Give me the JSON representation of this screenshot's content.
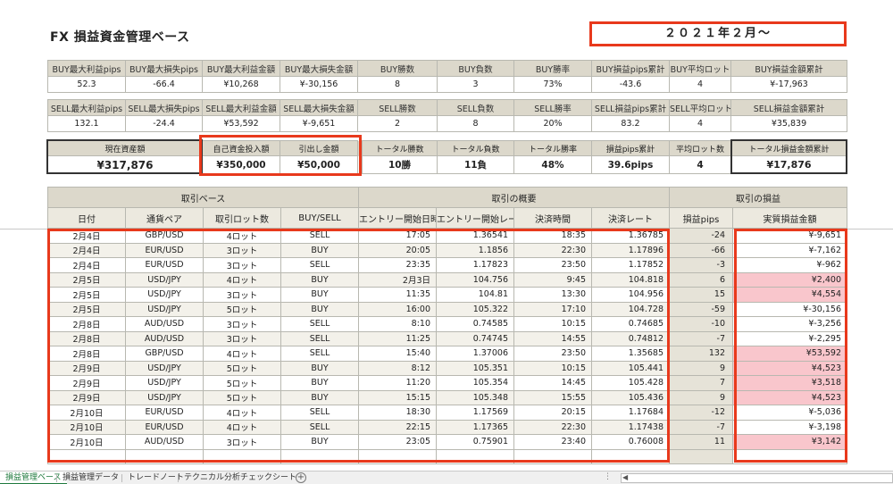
{
  "title": "FX 損益資金管理ベース",
  "date_label": "２０２１年２月～",
  "buy_stats": {
    "headers": [
      "BUY最大利益pips",
      "BUY最大損失pips",
      "BUY最大利益金額",
      "BUY最大損失金額",
      "BUY勝数",
      "BUY負数",
      "BUY勝率",
      "BUY損益pips累計",
      "BUY平均ロット",
      "BUY損益金額累計"
    ],
    "values": [
      "52.3",
      "-66.4",
      "¥10,268",
      "¥-30,156",
      "8",
      "3",
      "73%",
      "-43.6",
      "4",
      "¥-17,963"
    ]
  },
  "sell_stats": {
    "headers": [
      "SELL最大利益pips",
      "SELL最大損失pips",
      "SELL最大利益金額",
      "SELL最大損失金額",
      "SELL勝数",
      "SELL負数",
      "SELL勝率",
      "SELL損益pips累計",
      "SELL平均ロット",
      "SELL損益金額累計"
    ],
    "values": [
      "132.1",
      "-24.4",
      "¥53,592",
      "¥-9,651",
      "2",
      "8",
      "20%",
      "83.2",
      "4",
      "¥35,839"
    ]
  },
  "summary": {
    "current_assets_label": "現在資産額",
    "current_assets": "¥317,876",
    "investment_label": "自己資金投入額",
    "investment": "¥350,000",
    "withdrawal_label": "引出し金額",
    "withdrawal": "¥50,000",
    "total_wins_label": "トータル勝数",
    "total_wins": "10勝",
    "total_losses_label": "トータル負数",
    "total_losses": "11負",
    "total_winrate_label": "トータル勝率",
    "total_winrate": "48%",
    "pips_total_label": "損益pips累計",
    "pips_total": "39.6pips",
    "avg_lot_label": "平均ロット数",
    "avg_lot": "4",
    "total_pl_label": "トータル損益金額累計",
    "total_pl": "¥17,876"
  },
  "trade_table": {
    "groups": [
      "取引ベース",
      "取引の概要",
      "取引の損益"
    ],
    "columns": [
      "日付",
      "通貨ペア",
      "取引ロット数",
      "BUY/SELL",
      "エントリー開始日時",
      "エントリー開始レート",
      "決済時間",
      "決済レート",
      "損益pips",
      "実質損益金額"
    ],
    "rows": [
      [
        "2月4日",
        "GBP/USD",
        "4ロット",
        "SELL",
        "17:05",
        "1.36541",
        "18:35",
        "1.36785",
        "-24",
        "¥-9,651"
      ],
      [
        "2月4日",
        "EUR/USD",
        "3ロット",
        "BUY",
        "20:05",
        "1.1856",
        "22:30",
        "1.17896",
        "-66",
        "¥-7,162"
      ],
      [
        "2月4日",
        "EUR/USD",
        "3ロット",
        "SELL",
        "23:35",
        "1.17823",
        "23:50",
        "1.17852",
        "-3",
        "¥-962"
      ],
      [
        "2月5日",
        "USD/JPY",
        "4ロット",
        "BUY",
        "2月3日",
        "104.756",
        "9:45",
        "104.818",
        "6",
        "¥2,400"
      ],
      [
        "2月5日",
        "USD/JPY",
        "3ロット",
        "BUY",
        "11:35",
        "104.81",
        "13:30",
        "104.956",
        "15",
        "¥4,554"
      ],
      [
        "2月5日",
        "USD/JPY",
        "5ロット",
        "BUY",
        "16:00",
        "105.322",
        "17:10",
        "104.728",
        "-59",
        "¥-30,156"
      ],
      [
        "2月8日",
        "AUD/USD",
        "3ロット",
        "SELL",
        "8:10",
        "0.74585",
        "10:15",
        "0.74685",
        "-10",
        "¥-3,256"
      ],
      [
        "2月8日",
        "AUD/USD",
        "3ロット",
        "SELL",
        "11:25",
        "0.74745",
        "14:55",
        "0.74812",
        "-7",
        "¥-2,295"
      ],
      [
        "2月8日",
        "GBP/USD",
        "4ロット",
        "SELL",
        "15:40",
        "1.37006",
        "23:50",
        "1.35685",
        "132",
        "¥53,592"
      ],
      [
        "2月9日",
        "USD/JPY",
        "5ロット",
        "BUY",
        "8:12",
        "105.351",
        "10:15",
        "105.441",
        "9",
        "¥4,523"
      ],
      [
        "2月9日",
        "USD/JPY",
        "5ロット",
        "BUY",
        "11:20",
        "105.354",
        "14:45",
        "105.428",
        "7",
        "¥3,518"
      ],
      [
        "2月9日",
        "USD/JPY",
        "5ロット",
        "BUY",
        "15:15",
        "105.348",
        "15:55",
        "105.436",
        "9",
        "¥4,523"
      ],
      [
        "2月10日",
        "EUR/USD",
        "4ロット",
        "SELL",
        "18:30",
        "1.17569",
        "20:15",
        "1.17684",
        "-12",
        "¥-5,036"
      ],
      [
        "2月10日",
        "EUR/USD",
        "4ロット",
        "SELL",
        "22:15",
        "1.17365",
        "22:30",
        "1.17438",
        "-7",
        "¥-3,198"
      ],
      [
        "2月10日",
        "AUD/USD",
        "3ロット",
        "BUY",
        "23:05",
        "0.75901",
        "23:40",
        "0.76008",
        "11",
        "¥3,142"
      ]
    ]
  },
  "sheet_tabs": [
    "損益管理ベース",
    "損益管理データ",
    "トレードノート",
    "テクニカル分析チェックシート"
  ],
  "colors": {
    "highlight_red": "#e8391c",
    "profit_fill": "#f9c6cc",
    "header_fill": "#dcd8cb"
  },
  "icons": [
    "add-sheet-icon",
    "scroll-left-icon"
  ]
}
